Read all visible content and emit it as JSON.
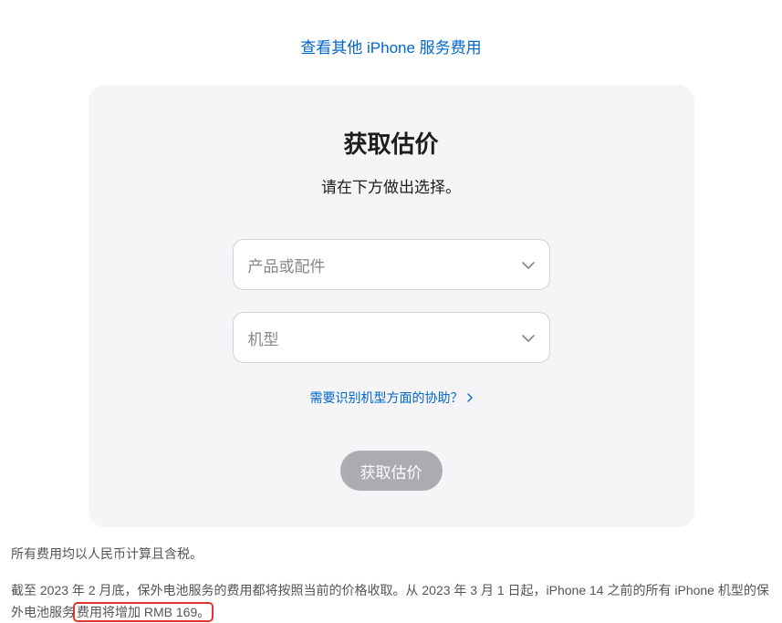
{
  "topLink": "查看其他 iPhone 服务费用",
  "card": {
    "title": "获取估价",
    "subtitle": "请在下方做出选择。",
    "select1": {
      "placeholder": "产品或配件"
    },
    "select2": {
      "placeholder": "机型"
    },
    "helpLink": "需要识别机型方面的协助？",
    "button": "获取估价"
  },
  "footnote": {
    "line1": "所有费用均以人民币计算且含税。",
    "line2_pre": "截至 2023 年 2 月底，保外电池服务的费用都将按照当前的价格收取。从 2023 年 3 月 1 日起，iPhone 14 之前的所有 iPhone 机型的保外电池服务",
    "line2_highlight": "费用将增加 RMB 169。"
  }
}
